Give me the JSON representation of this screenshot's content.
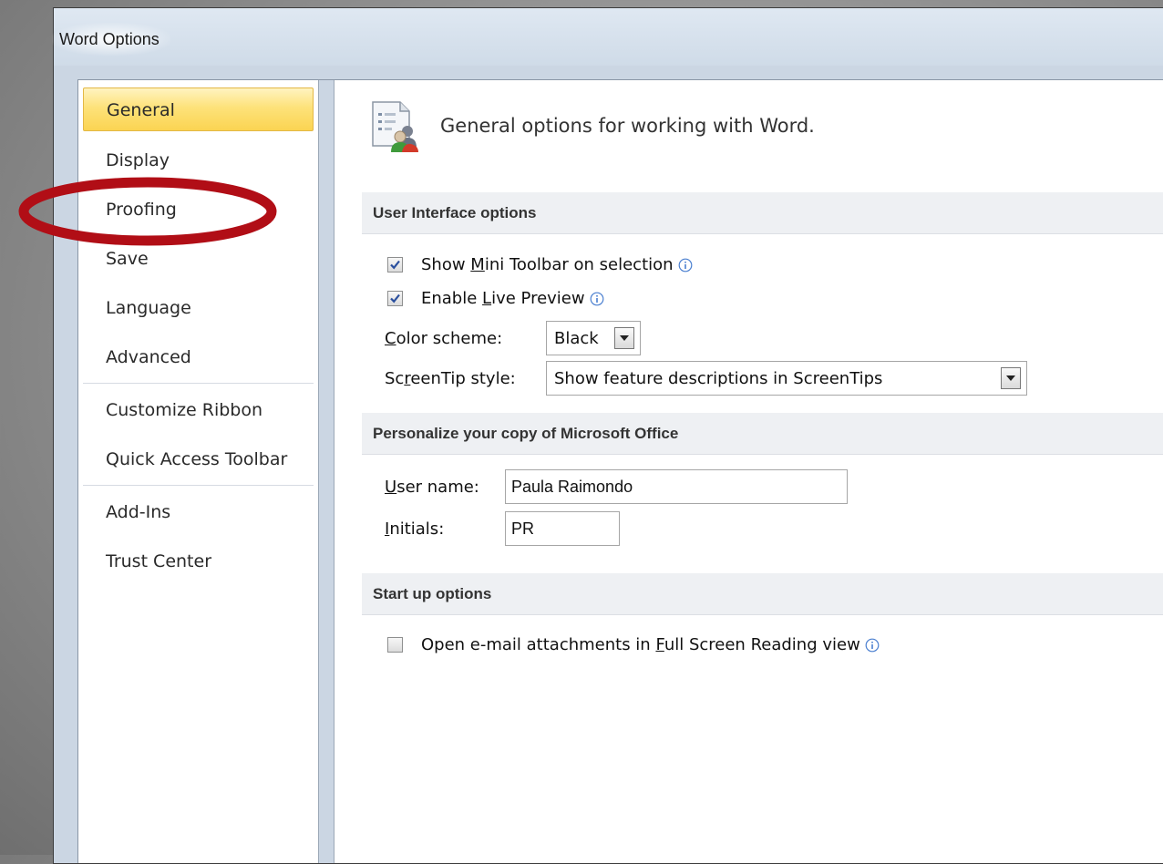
{
  "window": {
    "title": "Word Options"
  },
  "nav": {
    "items": [
      {
        "label": "General",
        "selected": true
      },
      {
        "label": "Display"
      },
      {
        "label": "Proofing"
      },
      {
        "label": "Save"
      },
      {
        "label": "Language"
      },
      {
        "label": "Advanced"
      },
      {
        "label": "Customize Ribbon"
      },
      {
        "label": "Quick Access Toolbar"
      },
      {
        "label": "Add-Ins"
      },
      {
        "label": "Trust Center"
      }
    ]
  },
  "page": {
    "heading": "General options for working with Word."
  },
  "ui_options": {
    "header": "User Interface options",
    "mini_toolbar": {
      "pre": "Show ",
      "key": "M",
      "post": "ini Toolbar on selection",
      "checked": true
    },
    "live_preview": {
      "pre": "Enable ",
      "key": "L",
      "post": "ive Preview",
      "checked": true
    },
    "color_scheme": {
      "key": "C",
      "post": "olor scheme:",
      "value": "Black"
    },
    "screentip": {
      "pre": "Sc",
      "key": "r",
      "post": "eenTip style:",
      "value": "Show feature descriptions in ScreenTips"
    }
  },
  "personalize": {
    "header": "Personalize your copy of Microsoft Office",
    "user_name": {
      "key": "U",
      "post": "ser name:",
      "value": "Paula Raimondo"
    },
    "initials": {
      "key": "I",
      "post": "nitials:",
      "value": "PR"
    }
  },
  "startup": {
    "header": "Start up options",
    "full_screen": {
      "pre": "Open e-mail attachments in ",
      "key": "F",
      "post": "ull Screen Reading view",
      "checked": false
    }
  },
  "colors": {
    "annotation": "#b10e16",
    "nav_selected": "#fbd452",
    "chrome": "#cbd6e3"
  }
}
